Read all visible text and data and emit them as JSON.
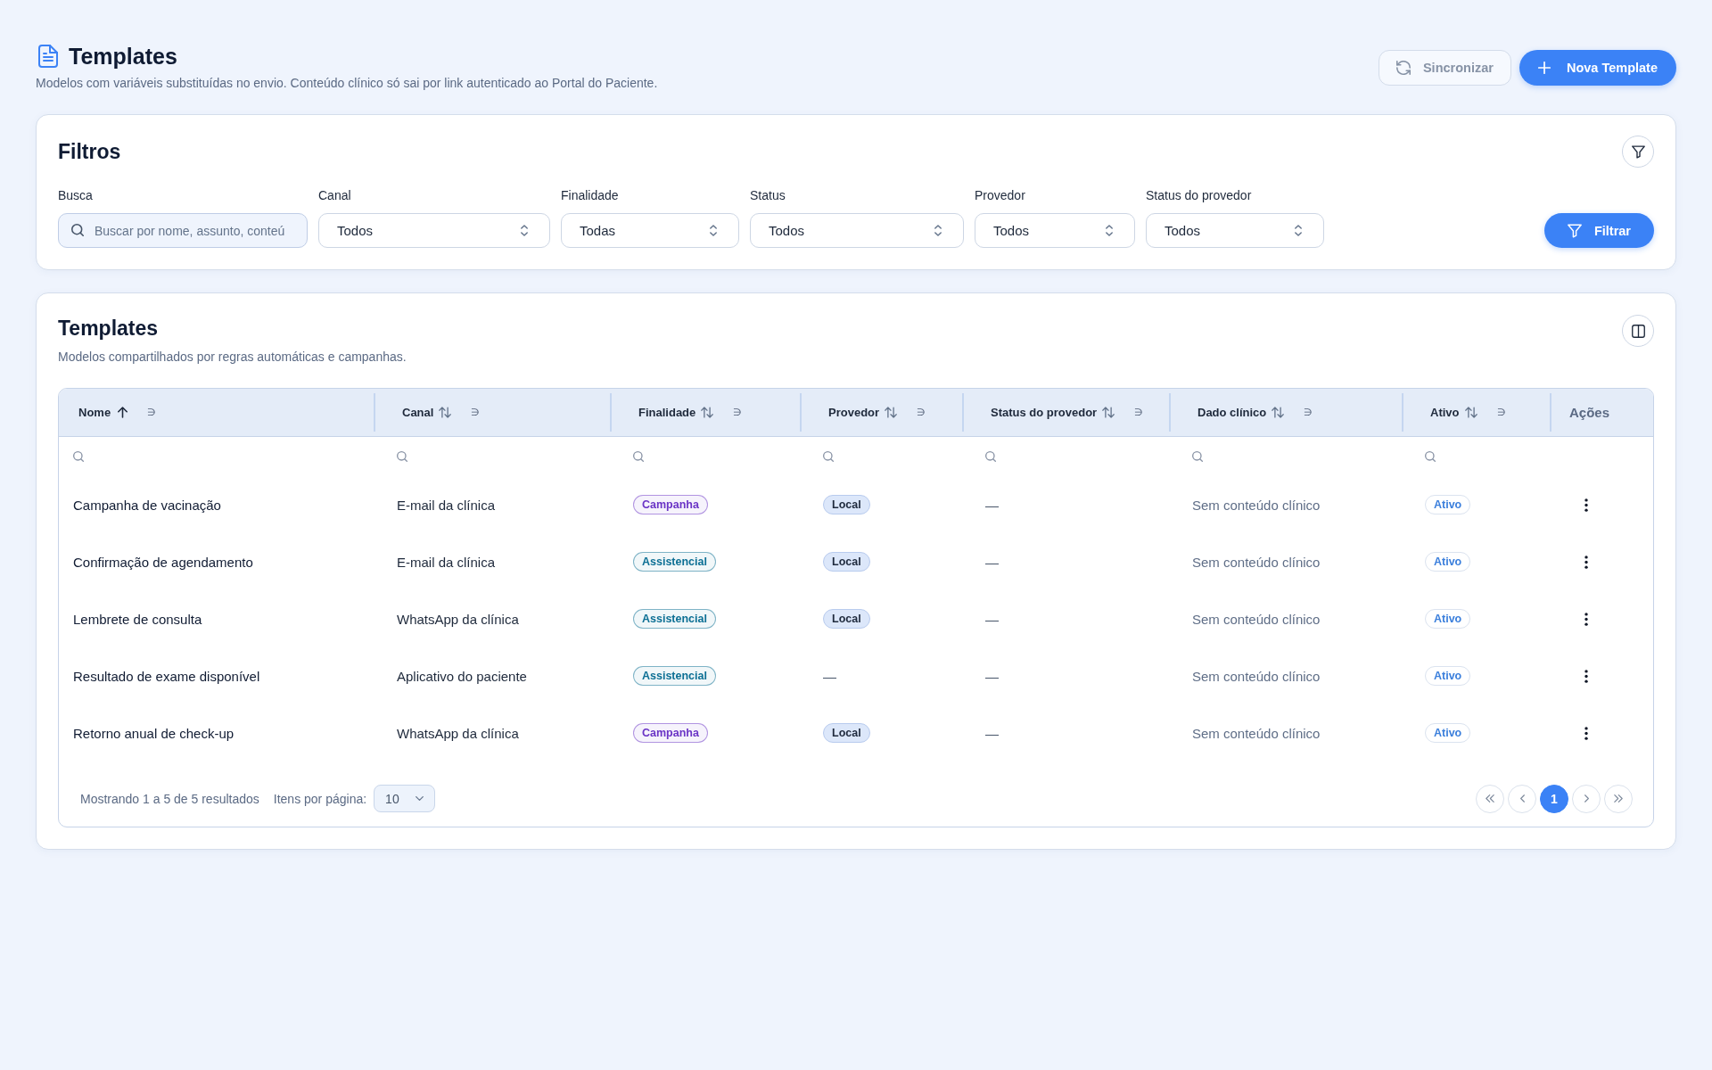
{
  "header": {
    "title": "Templates",
    "subtitle": "Modelos com variáveis substituídas no envio. Conteúdo clínico só sai por link autenticado ao Portal do Paciente.",
    "actions": [
      {
        "kind": "sync",
        "label": "Sincronizar",
        "disabled": true
      },
      {
        "kind": "create",
        "label": "Nova Template",
        "disabled": false
      }
    ]
  },
  "filters": {
    "title": "Filtros",
    "fields": [
      {
        "kind": "search",
        "label": "Busca",
        "placeholder": "Buscar por nome, assunto, conteú"
      },
      {
        "kind": "select",
        "label": "Canal",
        "value": "Todos"
      },
      {
        "kind": "select",
        "label": "Finalidade",
        "value": "Todas"
      },
      {
        "kind": "select",
        "label": "Status",
        "value": "Todos"
      },
      {
        "kind": "select",
        "label": "Provedor",
        "value": "Todos"
      },
      {
        "kind": "select",
        "label": "Status do provedor",
        "value": "Todos"
      }
    ],
    "apply_button": "Filtrar"
  },
  "table": {
    "title": "Templates",
    "subtitle": "Modelos compartilhados por regras automáticas e campanhas.",
    "columns": [
      {
        "kind": "data",
        "label": "Nome",
        "sorted": true,
        "menu": "∋"
      },
      {
        "kind": "data",
        "label": "Canal",
        "sorted": false,
        "menu": "∋"
      },
      {
        "kind": "data",
        "label": "Finalidade",
        "sorted": false,
        "menu": "∋"
      },
      {
        "kind": "data",
        "label": "Provedor",
        "sorted": false,
        "menu": "∋"
      },
      {
        "kind": "data",
        "label": "Status do provedor",
        "sorted": false,
        "menu": "∋"
      },
      {
        "kind": "data",
        "label": "Dado clínico",
        "sorted": false,
        "menu": "∋"
      },
      {
        "kind": "data",
        "label": "Ativo",
        "sorted": false,
        "menu": "∋"
      },
      {
        "kind": "actions",
        "label": "Ações"
      }
    ],
    "rows": [
      {
        "name": "Campanha de vacinação",
        "canal": "E-mail da clínica",
        "finalidade": {
          "text": "Campanha",
          "color": "#6b35c6"
        },
        "provedor": {
          "kind": "badge",
          "text": "Local"
        },
        "status_provedor": "—",
        "dado_clinico": "Sem conteúdo clínico",
        "ativo": "Ativo"
      },
      {
        "name": "Confirmação de agendamento",
        "canal": "E-mail da clínica",
        "finalidade": {
          "text": "Assistencial",
          "color": "#0c6f94"
        },
        "provedor": {
          "kind": "badge",
          "text": "Local"
        },
        "status_provedor": "—",
        "dado_clinico": "Sem conteúdo clínico",
        "ativo": "Ativo"
      },
      {
        "name": "Lembrete de consulta",
        "canal": "WhatsApp da clínica",
        "finalidade": {
          "text": "Assistencial",
          "color": "#0c6f94"
        },
        "provedor": {
          "kind": "badge",
          "text": "Local"
        },
        "status_provedor": "—",
        "dado_clinico": "Sem conteúdo clínico",
        "ativo": "Ativo"
      },
      {
        "name": "Resultado de exame disponível",
        "canal": "Aplicativo do paciente",
        "finalidade": {
          "text": "Assistencial",
          "color": "#0c6f94"
        },
        "provedor": {
          "kind": "text",
          "text": "—"
        },
        "status_provedor": "—",
        "dado_clinico": "Sem conteúdo clínico",
        "ativo": "Ativo"
      },
      {
        "name": "Retorno anual de check-up",
        "canal": "WhatsApp da clínica",
        "finalidade": {
          "text": "Campanha",
          "color": "#6b35c6"
        },
        "provedor": {
          "kind": "badge",
          "text": "Local"
        },
        "status_provedor": "—",
        "dado_clinico": "Sem conteúdo clínico",
        "ativo": "Ativo"
      }
    ],
    "pagination": {
      "summary": "Mostrando 1 a 5 de 5 resultados",
      "per_page_label": "Itens por página:",
      "per_page": "10",
      "pages": [
        {
          "label": "1",
          "selected": true
        }
      ]
    }
  }
}
